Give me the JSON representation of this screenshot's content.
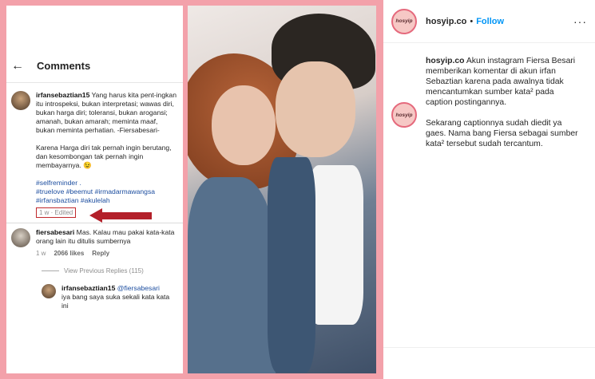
{
  "left_screenshot": {
    "header_title": "Comments",
    "comment1": {
      "username": "irfansebaztian15",
      "text": "Yang harus kita pent-ingkan itu introspeksi, bukan interpretasi; wawas diri, bukan harga diri; toleransi, bukan arogansi; amanah, bukan amarah; meminta maaf, bukan meminta perhatian. -Fiersabesari-",
      "text2": "Karena Harga diri tak pernah ingin berutang, dan kesombongan tak pernah ingin membayarnya. 😉",
      "tags1": "#selfreminder .",
      "tags2": "#truelove #beemut #irmadarmawangsa",
      "tags3": "#irfansbaztian #akulelah",
      "meta": "1 w · Edited"
    },
    "comment2": {
      "username": "fiersabesari",
      "text": "Mas. Kalau mau pakai kata-kata orang lain itu ditulis sumbernya",
      "time": "1 w",
      "likes": "2066 likes",
      "reply": "Reply"
    },
    "view_replies": "View Previous Replies (115)",
    "reply": {
      "username": "irfansebaztian15",
      "mention": "@fiersabesari",
      "text": "iya bang saya suka sekali kata kata ini"
    }
  },
  "post": {
    "username": "hosyip.co",
    "separator": "•",
    "follow_label": "Follow",
    "more_label": "···",
    "logo_text": "hosyip",
    "caption_username": "hosyip.co",
    "caption": "Akun instagram Fiersa Besari memberikan komentar di akun irfan Sebaztian karena pada awalnya tidak mencantumkan sumber kata² pada caption postingannya.",
    "caption2": "Sekarang captionnya sudah diedit ya gaes. Nama bang Fiersa sebagai sumber kata² tersebut sudah tercantum."
  },
  "colors": {
    "frame_pink": "#f3a1aa",
    "follow_blue": "#0095f6",
    "annotation_red": "#b3202a"
  }
}
